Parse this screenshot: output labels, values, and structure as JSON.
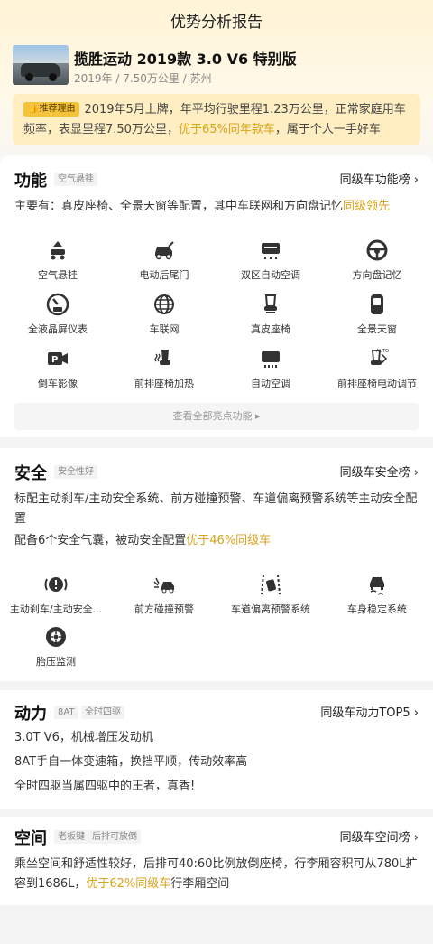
{
  "header": {
    "title": "优势分析报告"
  },
  "car": {
    "name": "揽胜运动 2019款 3.0 V6 特别版",
    "meta": "2019年 / 7.50万公里 / 苏州"
  },
  "reason": {
    "badge": "推荐理由",
    "text_before": "2019年5月上牌，年平均行驶里程1.23万公里，正常家庭用车频率，表显里程7.50万公里，",
    "highlight": "优于65%同年款车",
    "text_after": "，属于个人一手好车"
  },
  "function": {
    "title": "功能",
    "tag": "空气悬挂",
    "link": "同级车功能榜",
    "summary_prefix": "主要有：真皮座椅、全景天窗等配置，其中车联网和方向盘记忆",
    "summary_hl": "同级领先",
    "items": [
      {
        "label": "空气悬挂",
        "icon": "air-suspension-icon"
      },
      {
        "label": "电动后尾门",
        "icon": "power-tailgate-icon"
      },
      {
        "label": "双区自动空调",
        "icon": "dual-zone-ac-icon"
      },
      {
        "label": "方向盘记忆",
        "icon": "steering-wheel-icon"
      },
      {
        "label": "全液晶屏仪表",
        "icon": "lcd-cluster-icon"
      },
      {
        "label": "车联网",
        "icon": "globe-icon"
      },
      {
        "label": "真皮座椅",
        "icon": "leather-seat-icon"
      },
      {
        "label": "全景天窗",
        "icon": "sunroof-icon"
      },
      {
        "label": "倒车影像",
        "icon": "reverse-camera-icon"
      },
      {
        "label": "前排座椅加热",
        "icon": "seat-heating-icon"
      },
      {
        "label": "自动空调",
        "icon": "auto-ac-icon"
      },
      {
        "label": "前排座椅电动调节",
        "icon": "power-seat-icon"
      }
    ],
    "view_all": "查看全部亮点功能 ▸"
  },
  "safety": {
    "title": "安全",
    "tag": "安全性好",
    "link": "同级车安全榜",
    "text1": "标配主动刹车/主动安全系统、前方碰撞预警、车道偏离预警系统等主动安全配置",
    "text2_prefix": "配备6个安全气囊，被动安全配置",
    "text2_hl": "优于46%同级车",
    "items": [
      {
        "label": "主动刹车/主动安全...",
        "icon": "brake-warning-icon"
      },
      {
        "label": "前方碰撞预警",
        "icon": "collision-warning-icon"
      },
      {
        "label": "车道偏离预警系统",
        "icon": "lane-departure-icon"
      },
      {
        "label": "车身稳定系统",
        "icon": "stability-control-icon"
      },
      {
        "label": "胎压监测",
        "icon": "tire-pressure-icon"
      }
    ]
  },
  "power": {
    "title": "动力",
    "tags": [
      "8AT",
      "全时四驱"
    ],
    "link": "同级车动力TOP5",
    "lines": [
      "3.0T V6，机械增压发动机",
      "8AT手自一体变速箱，换挡平顺，传动效率高",
      "全时四驱当属四驱中的王者，真香!"
    ]
  },
  "space": {
    "title": "空间",
    "tags": [
      "老板键",
      "后排可放倒"
    ],
    "link": "同级车空间榜",
    "text_prefix": "乘坐空间和舒适性较好，后排可40:60比例放倒座椅，行李厢容积可从780L扩容到1686L，",
    "text_hl": "优于62%同级车",
    "text_suffix": "行李厢空间"
  },
  "colors": {
    "accent": "#f5c33b",
    "highlight": "#d9a21b",
    "hero_bg": "#fff4d6",
    "reason_bg": "#ffeec2"
  }
}
